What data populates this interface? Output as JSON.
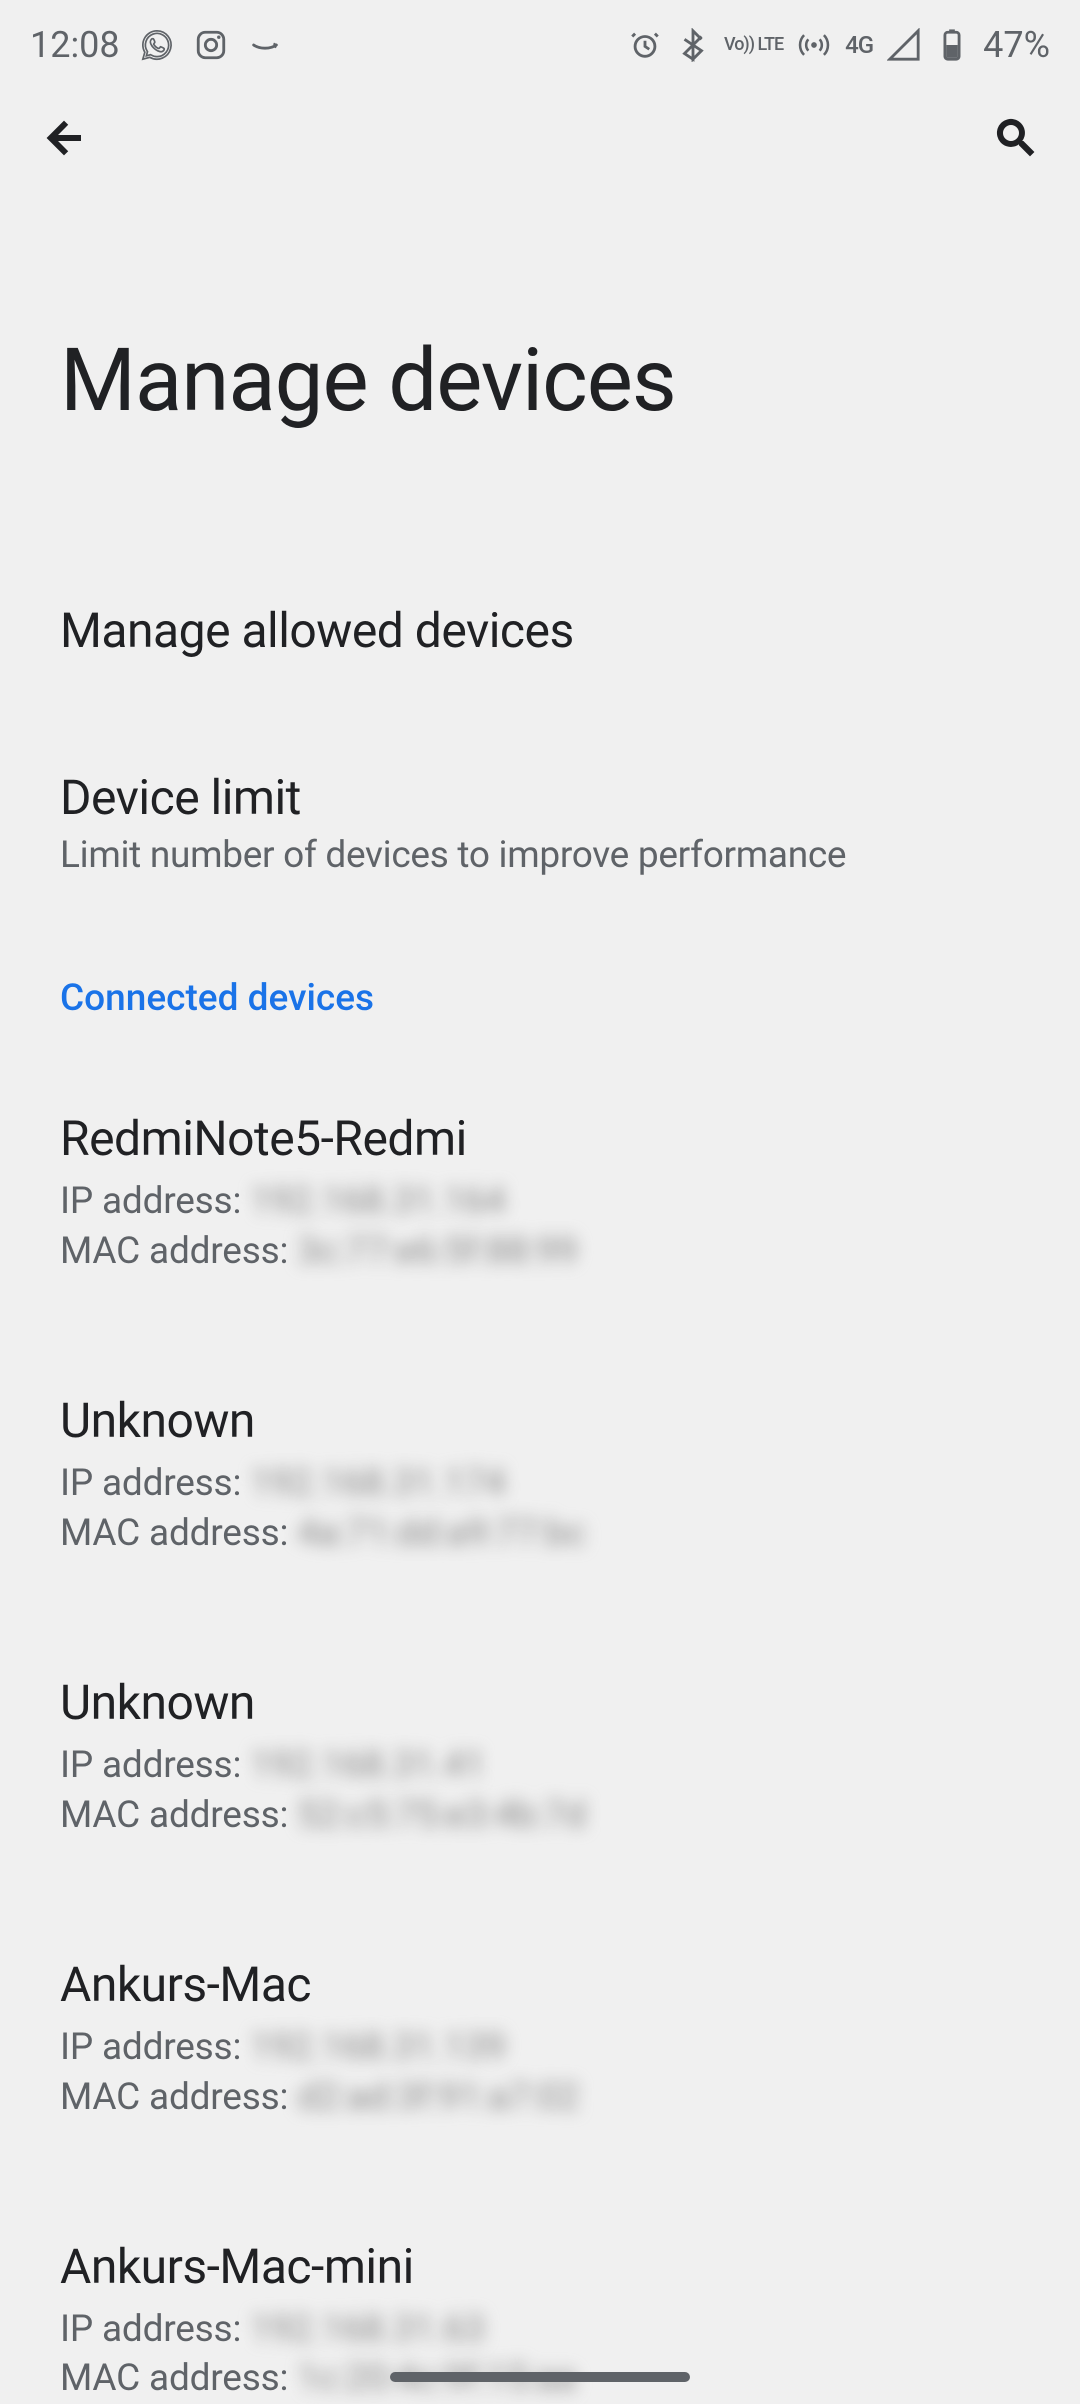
{
  "status": {
    "time": "12:08",
    "network_label": "4G",
    "volte_label": "Vo)) LTE",
    "battery": "47%"
  },
  "header": {
    "title": "Manage devices"
  },
  "items": {
    "manage_allowed": {
      "title": "Manage allowed devices"
    },
    "device_limit": {
      "title": "Device limit",
      "subtitle": "Limit number of devices to improve performance"
    }
  },
  "section_header": "Connected devices",
  "devices": [
    {
      "name": "RedmiNote5-Redmi",
      "ip_label": "IP address: ",
      "ip_value": "192.168.31.164",
      "mac_label": "MAC address: ",
      "mac_value": "3c:77:e6:5f:88:99"
    },
    {
      "name": "Unknown",
      "ip_label": "IP address: ",
      "ip_value": "192.168.31.174",
      "mac_label": "MAC address: ",
      "mac_value": "4a:71:dd:a9:77:bc"
    },
    {
      "name": "Unknown",
      "ip_label": "IP address: ",
      "ip_value": "192.168.31.41",
      "mac_label": "MAC address: ",
      "mac_value": "52:c5:75:e3:4b:7d"
    },
    {
      "name": "Ankurs-Mac",
      "ip_label": "IP address: ",
      "ip_value": "192.168.31.139",
      "mac_label": "MAC address: ",
      "mac_value": "d2:ad:3f:91:a7:02"
    },
    {
      "name": "Ankurs-Mac-mini",
      "ip_label": "IP address: ",
      "ip_value": "192.168.31.63",
      "mac_label": "MAC address: ",
      "mac_value": "1c:20:4c:9f:15:aa"
    }
  ]
}
